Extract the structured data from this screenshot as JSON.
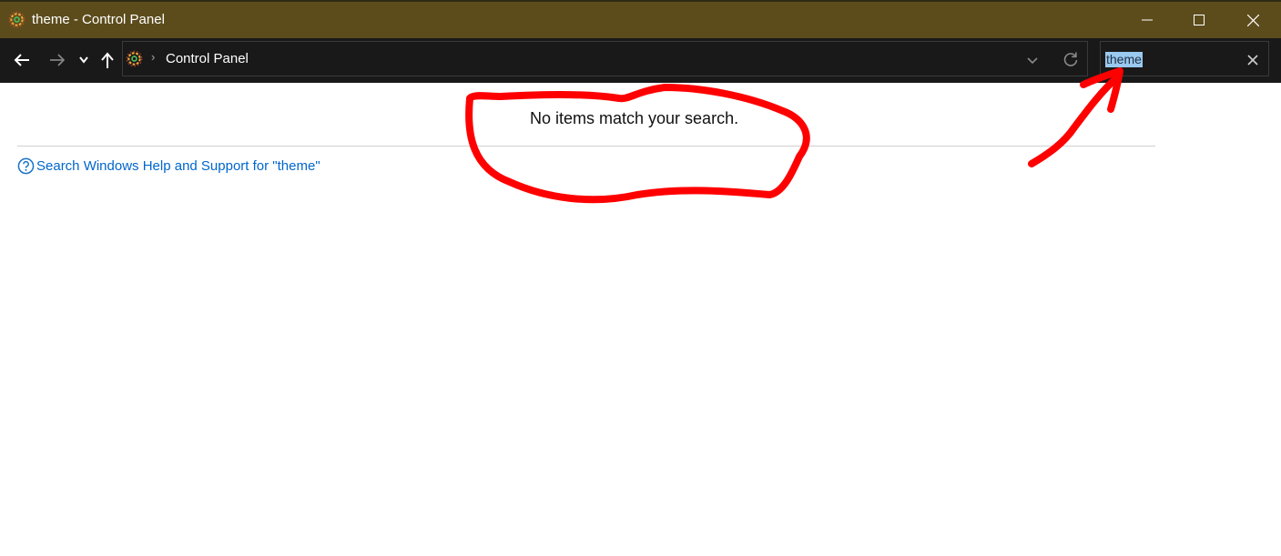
{
  "window": {
    "title": "theme - Control Panel"
  },
  "address": {
    "crumb": "Control Panel"
  },
  "search": {
    "value": "theme"
  },
  "content": {
    "no_items_message": "No items match your search.",
    "help_link": "Search Windows Help and Support for \"theme\""
  },
  "icons": {
    "app": "control-panel-icon",
    "back": "back-arrow-icon",
    "forward": "forward-arrow-icon",
    "recent": "chevron-down-icon",
    "up": "up-arrow-icon",
    "dropdown": "chevron-down-icon",
    "refresh": "refresh-icon",
    "clear": "close-icon",
    "help": "help-icon",
    "minimize": "minimize-icon",
    "maximize": "maximize-icon",
    "close": "close-icon"
  },
  "colors": {
    "titlebar": "#5c4c1c",
    "addressbar": "#191919",
    "link": "#0066cc",
    "annotation": "#ff0000",
    "selection": "#99c9ef"
  }
}
